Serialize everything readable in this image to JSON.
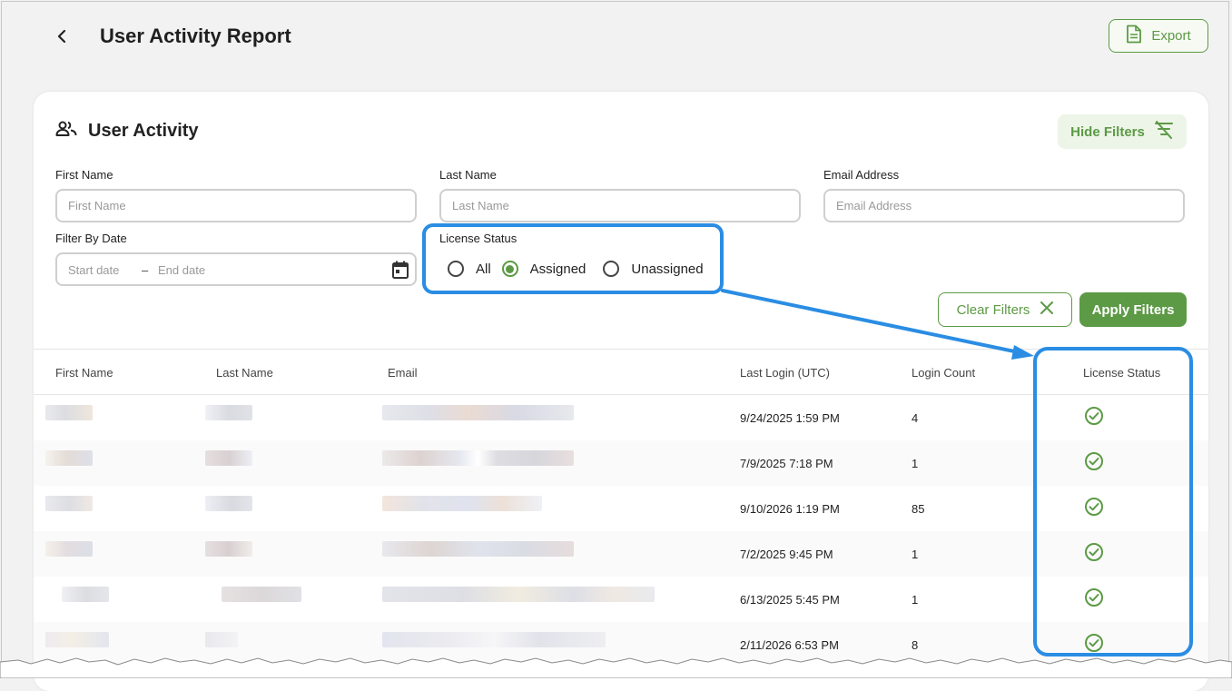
{
  "header": {
    "title": "User Activity Report",
    "export_label": "Export"
  },
  "card": {
    "title": "User Activity",
    "hide_filters_label": "Hide Filters"
  },
  "filters": {
    "first_name": {
      "label": "First Name",
      "placeholder": "First Name",
      "value": ""
    },
    "last_name": {
      "label": "Last Name",
      "placeholder": "Last Name",
      "value": ""
    },
    "email": {
      "label": "Email Address",
      "placeholder": "Email Address",
      "value": ""
    },
    "date": {
      "label": "Filter By Date",
      "start_placeholder": "Start date",
      "separator": "–",
      "end_placeholder": "End date"
    },
    "license_status": {
      "label": "License Status",
      "options": [
        "All",
        "Assigned",
        "Unassigned"
      ],
      "selected": "Assigned"
    },
    "clear_label": "Clear Filters",
    "apply_label": "Apply Filters"
  },
  "table": {
    "columns": [
      "First Name",
      "Last Name",
      "Email",
      "Last Login (UTC)",
      "Login Count",
      "License Status"
    ],
    "rows": [
      {
        "last_login": "9/24/2025 1:59 PM",
        "login_count": "4",
        "license": "check-circle-icon"
      },
      {
        "last_login": "7/9/2025 7:18 PM",
        "login_count": "1",
        "license": "check-circle-icon"
      },
      {
        "last_login": "9/10/2026 1:19 PM",
        "login_count": "85",
        "license": "check-circle-icon"
      },
      {
        "last_login": "7/2/2025 9:45 PM",
        "login_count": "1",
        "license": "check-circle-icon"
      },
      {
        "last_login": "6/13/2025 5:45 PM",
        "login_count": "1",
        "license": "check-circle-icon"
      },
      {
        "last_login": "2/11/2026 6:53 PM",
        "login_count": "8",
        "license": "check-circle-icon"
      }
    ]
  },
  "colors": {
    "accent": "#5c9a45",
    "annotation": "#2a8de3"
  }
}
